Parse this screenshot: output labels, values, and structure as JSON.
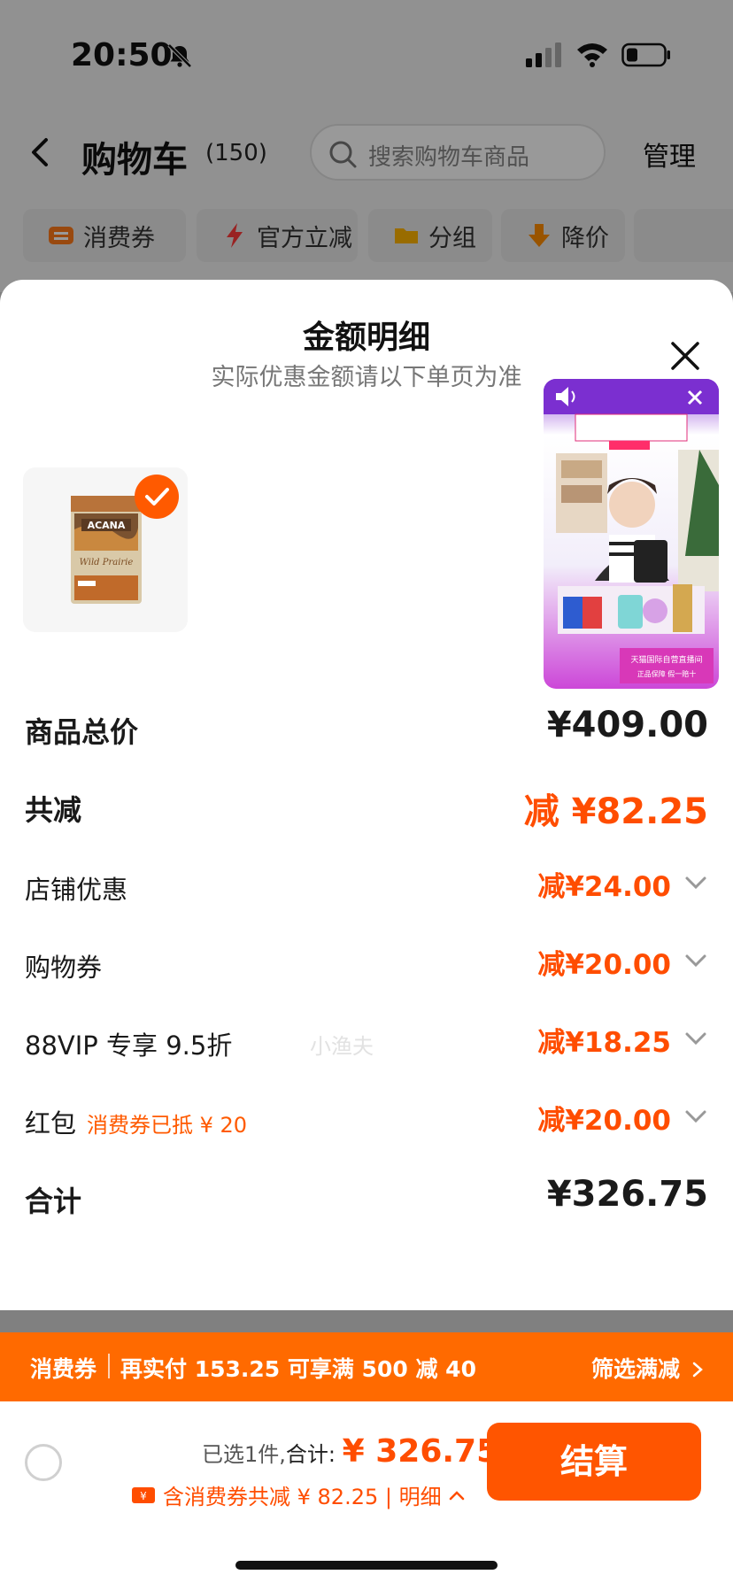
{
  "status_bar": {
    "time": "20:50"
  },
  "nav": {
    "title": "购物车",
    "count": "(150)",
    "search_placeholder": "搜索购物车商品",
    "manage": "管理"
  },
  "filters": [
    {
      "label": "消费券",
      "icon": "ticket-icon"
    },
    {
      "label": "官方立减",
      "icon": "lightning-icon"
    },
    {
      "label": "分组",
      "icon": "folder-icon"
    },
    {
      "label": "降价",
      "icon": "price-drop-icon"
    }
  ],
  "sheet": {
    "title": "金额明细",
    "subtitle": "实际优惠金额请以下单页为准",
    "product_brand": "ACANA",
    "product_name": "Wild Prairie",
    "rows": {
      "total_price": {
        "label": "商品总价",
        "value": "¥409.00"
      },
      "total_discount": {
        "label": "共减",
        "value": "减 ¥82.25"
      },
      "shop_discount": {
        "label": "店铺优惠",
        "value": "减¥24.00"
      },
      "shopping_coupon": {
        "label": "购物券",
        "value": "减¥20.00"
      },
      "vip_discount": {
        "label": "88VIP 专享 9.5折",
        "value": "减¥18.25"
      },
      "red_packet": {
        "label": "红包",
        "note": "消费券已抵 ¥ 20",
        "value": "减¥20.00"
      },
      "final_total": {
        "label": "合计",
        "value": "¥326.75"
      }
    },
    "watermark": "小渔夫",
    "live": {
      "banner": "天猫国际自营直播间",
      "sub": "正品保障 假一赔十"
    }
  },
  "promo_bar": {
    "tag": "消费券",
    "text": "再实付 153.25 可享满 500 减 40",
    "filter": "筛选满减"
  },
  "footer": {
    "selected": "已选1件,",
    "total_label": "合计:",
    "total_value": "¥ 326.75",
    "saving": "含消费券共减 ¥ 82.25 | 明细",
    "checkout": "结算"
  },
  "colors": {
    "accent": "#ff5500",
    "discount": "#ff4d00",
    "promo": "#ff6a00"
  }
}
